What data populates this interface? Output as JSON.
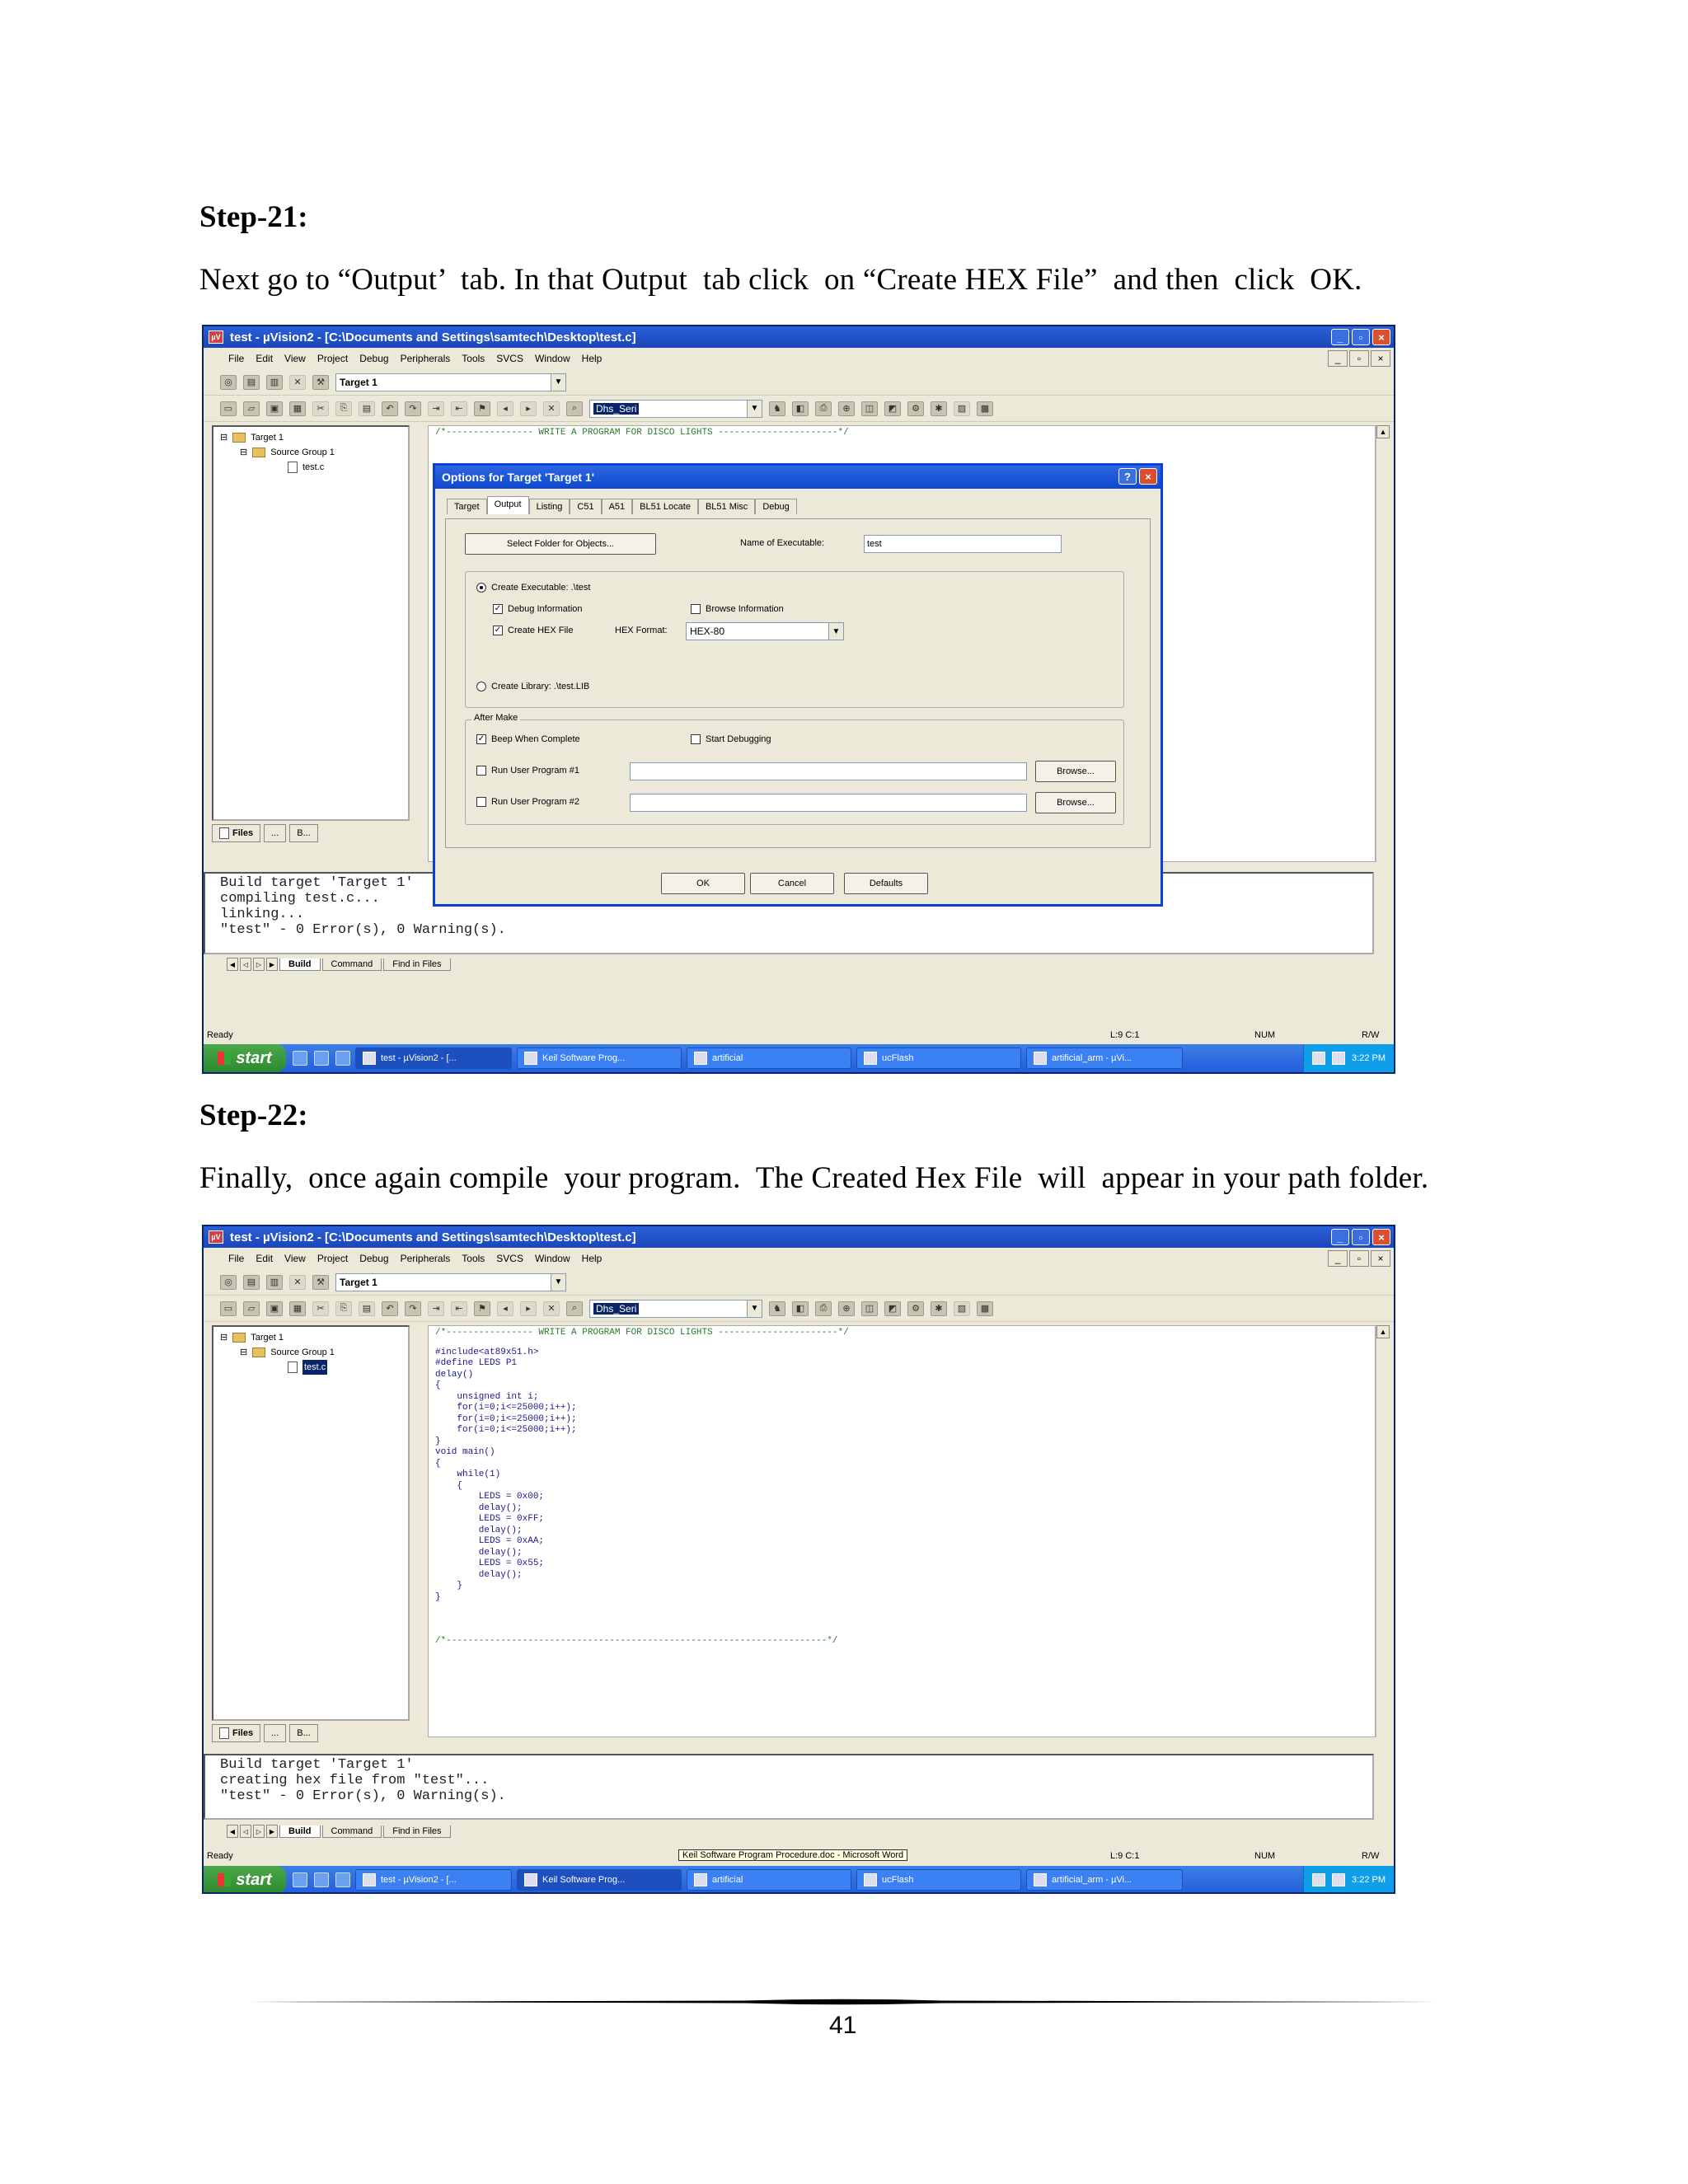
{
  "step21": {
    "title": "Step-21:",
    "text": "Next go to “Output’  tab. In that Output  tab click  on “Create HEX File”  and then  click  OK."
  },
  "step22": {
    "title": "Step-22:",
    "text": "Finally,  once again compile  your program.  The Created Hex File  will  appear in your path folder."
  },
  "page_number": "41",
  "window": {
    "title": "test - µVision2 - [C:\\Documents and Settings\\samtech\\Desktop\\test.c]",
    "menu": [
      "File",
      "Edit",
      "View",
      "Project",
      "Debug",
      "Peripherals",
      "Tools",
      "SVCS",
      "Window",
      "Help"
    ],
    "target_combo": "Target 1",
    "find_combo": "Dhs_Seri",
    "project_tree": {
      "target": "Target 1",
      "group": "Source Group 1",
      "file": "test.c"
    },
    "project_tabs": [
      "Files",
      "...",
      "B..."
    ],
    "editor_comment_top": "/*---------------- WRITE A PROGRAM FOR DISCO LIGHTS ----------------------*/",
    "editor_comment_bottom": "/*----------------------------------------------------------------------*/",
    "output_tabs": [
      "Build",
      "Command",
      "Find in Files"
    ],
    "status": {
      "ready": "Ready",
      "pos": "L:9 C:1",
      "num": "NUM",
      "rw": "R/W",
      "word_tip": "Keil Software Program Procedure.doc - Microsoft Word"
    }
  },
  "taskbar": {
    "start": "start",
    "tasks": [
      "test - µVision2 - [...",
      "Keil Software Prog...",
      "artificial",
      "ucFlash",
      "artificial_arm - µVi..."
    ],
    "time": "3:22 PM"
  },
  "shot1": {
    "build_output": [
      "Build target 'Target 1'",
      "compiling test.c...",
      "linking...",
      "\"test\" - 0 Error(s), 0 Warning(s)."
    ]
  },
  "shot2": {
    "build_output": [
      "Build target 'Target 1'",
      "creating hex file from \"test\"...",
      "\"test\" - 0 Error(s), 0 Warning(s)."
    ],
    "code": [
      "#include<at89x51.h>",
      "#define LEDS P1",
      "delay()",
      "{",
      "    unsigned int i;",
      "    for(i=0;i<=25000;i++);",
      "    for(i=0;i<=25000;i++);",
      "    for(i=0;i<=25000;i++);",
      "}",
      "void main()",
      "{",
      "    while(1)",
      "    {",
      "        LEDS = 0x00;",
      "        delay();",
      "        LEDS = 0xFF;",
      "        delay();",
      "        LEDS = 0xAA;",
      "        delay();",
      "        LEDS = 0x55;",
      "        delay();",
      "    }",
      "}"
    ]
  },
  "dialog": {
    "title": "Options for Target 'Target 1'",
    "tabs": [
      "Target",
      "Output",
      "Listing",
      "C51",
      "A51",
      "BL51 Locate",
      "BL51 Misc",
      "Debug"
    ],
    "select_folder": "Select Folder for Objects...",
    "name_exe_label": "Name of Executable:",
    "name_exe_value": "test",
    "create_exe": "Create Executable:  .\\test",
    "debug_info": "Debug Information",
    "browse_info": "Browse Information",
    "create_hex": "Create HEX File",
    "hex_format_label": "HEX Format:",
    "hex_format_value": "HEX-80",
    "create_lib": "Create Library:  .\\test.LIB",
    "after_make": "After Make",
    "beep": "Beep When Complete",
    "start_debug": "Start Debugging",
    "run_user1": "Run User Program #1",
    "run_user2": "Run User Program #2",
    "browse": "Browse...",
    "ok": "OK",
    "cancel": "Cancel",
    "defaults": "Defaults"
  }
}
